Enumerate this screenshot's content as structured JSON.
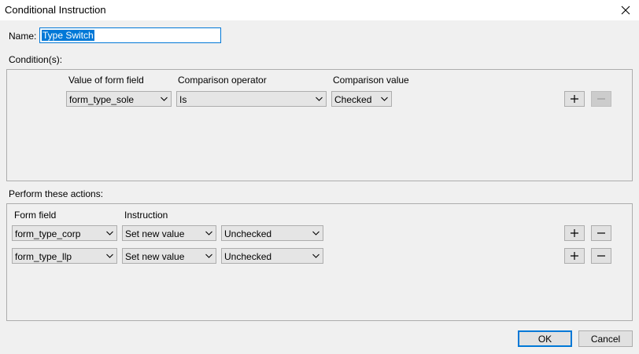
{
  "window": {
    "title": "Conditional Instruction"
  },
  "name": {
    "label": "Name:",
    "value": "Type Switch"
  },
  "conditions": {
    "label": "Condition(s):",
    "headers": {
      "field": "Value of form field",
      "operator": "Comparison operator",
      "value": "Comparison value"
    },
    "rows": [
      {
        "field": "form_type_sole",
        "operator": "Is",
        "value": "Checked"
      }
    ]
  },
  "actions": {
    "label": "Perform these actions:",
    "headers": {
      "field": "Form field",
      "instruction": "Instruction"
    },
    "rows": [
      {
        "field": "form_type_corp",
        "instruction": "Set new value",
        "value": "Unchecked"
      },
      {
        "field": "form_type_llp",
        "instruction": "Set new value",
        "value": "Unchecked"
      }
    ]
  },
  "buttons": {
    "ok": "OK",
    "cancel": "Cancel"
  },
  "colors": {
    "accent": "#0078d7",
    "border": "#adadad",
    "background": "#f0f0f0"
  }
}
